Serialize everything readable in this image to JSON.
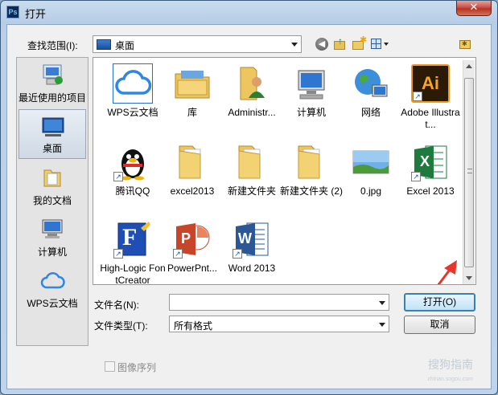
{
  "window": {
    "title": "打开",
    "app_icon_text": "Ps",
    "close_glyph": "✕"
  },
  "toolbar": {
    "lookin_label": "查找范围(I):",
    "lookin_value": "桌面"
  },
  "places": [
    {
      "label": "最近使用的项目"
    },
    {
      "label": "桌面"
    },
    {
      "label": "我的文档"
    },
    {
      "label": "计算机"
    },
    {
      "label": "WPS云文档"
    }
  ],
  "files": [
    {
      "label": "WPS云文档"
    },
    {
      "label": "库"
    },
    {
      "label": "Administr..."
    },
    {
      "label": "计算机"
    },
    {
      "label": "网络"
    },
    {
      "label": "Adobe Illustrat...",
      "icon_text": "Ai"
    },
    {
      "label": "腾讯QQ"
    },
    {
      "label": "excel2013"
    },
    {
      "label": "新建文件夹"
    },
    {
      "label": "新建文件夹 (2)"
    },
    {
      "label": "0.jpg"
    },
    {
      "label": "Excel 2013",
      "icon_text": "X"
    },
    {
      "label": "High-Logic FontCreator",
      "icon_text": "F"
    },
    {
      "label": "PowerPnt...",
      "icon_text": "P"
    },
    {
      "label": "Word 2013",
      "icon_text": "W"
    }
  ],
  "form": {
    "filename_label": "文件名(N):",
    "filename_value": "",
    "filetype_label": "文件类型(T):",
    "filetype_value": "所有格式",
    "open_label": "打开(O)",
    "cancel_label": "取消",
    "image_sequence_label": "图像序列"
  },
  "watermark": {
    "text": "搜狗指南",
    "url": "zhinan.sogou.com"
  },
  "colors": {
    "accent_arrow": "#e8352e",
    "selection": "#2a6ecf"
  }
}
